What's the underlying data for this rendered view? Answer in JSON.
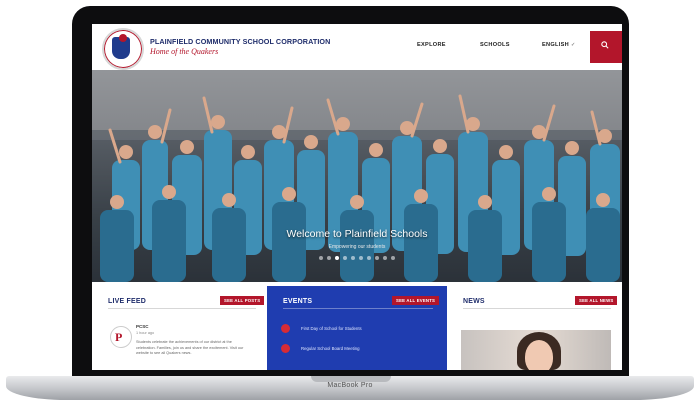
{
  "header": {
    "org_name": "PLAINFIELD COMMUNITY SCHOOL CORPORATION",
    "tagline": "Home of the Quakers",
    "nav": [
      {
        "label": "EXPLORE"
      },
      {
        "label": "SCHOOLS"
      },
      {
        "label": "ENGLISH"
      }
    ],
    "language_caret": "✓"
  },
  "hero": {
    "title": "Welcome to Plainfield Schools",
    "subtitle": "Empowering our students",
    "slide_count": 10,
    "active_slide": 2
  },
  "live_feed": {
    "heading": "LIVE FEED",
    "see_all": "SEE ALL POSTS",
    "post_name": "PCSC",
    "post_time": "1 hour ago",
    "post_text": "Students celebrate the achievements of our district at the celebration. Families, join us and share the excitement. Visit our website to see all Quakers news."
  },
  "events": {
    "heading": "EVENTS",
    "see_all": "SEE ALL EVENTS",
    "items": [
      {
        "title": "First Day of School for Students"
      },
      {
        "title": "Regular School Board Meeting"
      }
    ]
  },
  "news": {
    "heading": "NEWS",
    "see_all": "SEE ALL NEWS"
  },
  "device": {
    "label": "MacBook Pro"
  },
  "colors": {
    "brand_red": "#b3162b",
    "brand_navy": "#1f2d6b",
    "events_blue": "#1f3db0"
  }
}
